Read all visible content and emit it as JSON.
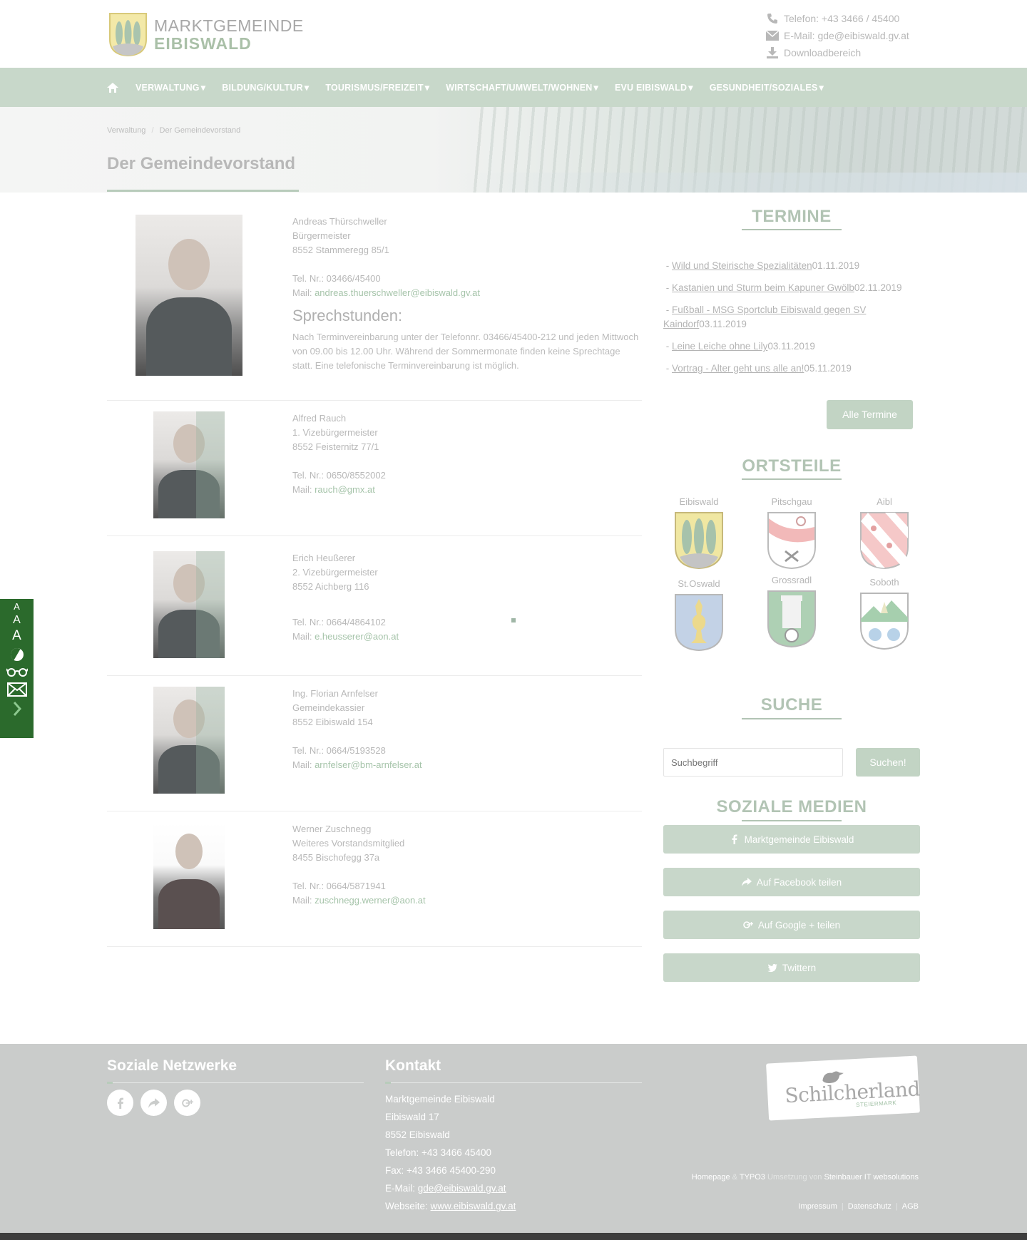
{
  "header": {
    "logo_line1": "MARKTGEMEINDE",
    "logo_line2": "EIBISWALD",
    "phone": "Telefon: +43 3466 / 45400",
    "email": "E-Mail: gde@eibiswald.gv.at",
    "download": "Downloadbereich"
  },
  "nav": {
    "items": [
      "VERWALTUNG",
      "BILDUNG/KULTUR",
      "TOURISMUS/FREIZEIT",
      "WIRTSCHAFT/UMWELT/WOHNEN",
      "EVU EIBISWALD",
      "GESUNDHEIT/SOZIALES"
    ]
  },
  "breadcrumb": [
    "Verwaltung",
    "Der Gemeindevorstand"
  ],
  "page_title": "Der Gemeindevorstand",
  "persons": [
    {
      "name": "Andreas Thürschweller",
      "role": "Bürgermeister",
      "address": "8552 Stammeregg 85/1",
      "tel": "Tel. Nr.: 03466/45400",
      "mail_label": "Mail:",
      "mail": "andreas.thuerschweller@eibiswald.gv.at"
    },
    {
      "name": "Alfred Rauch",
      "role": "1. Vizebürgermeister",
      "address": "8552 Feisternitz 77/1",
      "tel": "Tel. Nr.: 0650/8552002",
      "mail_label": "Mail:",
      "mail": "rauch@gmx.at"
    },
    {
      "name": "Erich Heußerer",
      "role": "2. Vizebürgermeister",
      "address": "8552 Aichberg 116",
      "tel": "Tel. Nr.: 0664/4864102",
      "mail_label": "Mail:",
      "mail": "e.heusserer@aon.at"
    },
    {
      "name": "Ing. Florian Arnfelser",
      "role": "Gemeindekassier",
      "address": "8552 Eibiswald 154",
      "tel": "Tel. Nr.: 0664/5193528",
      "mail_label": "Mail:",
      "mail": "arnfelser@bm-arnfelser.at"
    },
    {
      "name": "Werner Zuschnegg",
      "role": "Weiteres Vorstandsmitglied",
      "address": "8455 Bischofegg 37a",
      "tel": "Tel. Nr.: 0664/5871941",
      "mail_label": "Mail:",
      "mail": "zuschnegg.werner@aon.at"
    }
  ],
  "sprechstunden": {
    "title": "Sprechstunden:",
    "text": "Nach Terminvereinbarung unter der Telefonnr. 03466/45400-212 und jeden Mittwoch von 09.00 bis 12.00 Uhr. Während der Sommermonate finden keine Sprechtage statt. Eine telefonische Terminvereinbarung ist möglich."
  },
  "termine": {
    "title": "TERMINE",
    "items": [
      {
        "title": "Wild und Steirische Spezialitäten",
        "date": "01.11.2019"
      },
      {
        "title": "Kastanien und Sturm beim Kapuner Gwölb",
        "date": "02.11.2019"
      },
      {
        "title": "Fußball - MSG Sportclub Eibiswald gegen SV Kaindorf",
        "date": "03.11.2019"
      },
      {
        "title": "Leine Leiche ohne Lily",
        "date": "03.11.2019"
      },
      {
        "title": "Vortrag - Alter geht uns alle an!",
        "date": "05.11.2019"
      }
    ],
    "all_button": "Alle Termine"
  },
  "ortsteile": {
    "title": "ORTSTEILE",
    "items": [
      "Eibiswald",
      "Pitschgau",
      "Aibl",
      "St.Oswald",
      "Grossradl",
      "Soboth"
    ]
  },
  "suche": {
    "title": "SUCHE",
    "placeholder": "Suchbegriff",
    "button": "Suchen!"
  },
  "soziale_medien": {
    "title": "SOZIALE MEDIEN",
    "buttons": [
      "Marktgemeinde Eibiswald",
      "Auf Facebook teilen",
      "Auf Google + teilen",
      "Twittern"
    ]
  },
  "a11y": {
    "font_small": "A",
    "font_medium": "A",
    "font_large": "A"
  },
  "footer": {
    "social_title": "Soziale Netzwerke",
    "kontakt_title": "Kontakt",
    "kontakt_lines": [
      "Marktgemeinde Eibiswald",
      "Eibiswald 17",
      "8552 Eibiswald",
      "Telefon: +43 3466 45400",
      "Fax: +43 3466 45400-290"
    ],
    "email_label": "E-Mail:",
    "email": "gde@eibiswald.gv.at",
    "web_label": "Webseite:",
    "web": "www.eibiswald.gv.at",
    "schilcher": "Schilcherland",
    "schilcher_sub": "STEIERMARK",
    "credits_1": "Homepage",
    "credits_amp": "&",
    "credits_2": "TYPO3",
    "credits_3": "Umsetzung von",
    "credits_4": "Steinbauer IT websolutions",
    "legal": [
      "Impressum",
      "Datenschutz",
      "AGB"
    ]
  },
  "colors": {
    "nav": "#c8d8ca",
    "accent": "#b2c4b4",
    "footer": "#cacccb",
    "a11y": "#2b6a2c"
  }
}
